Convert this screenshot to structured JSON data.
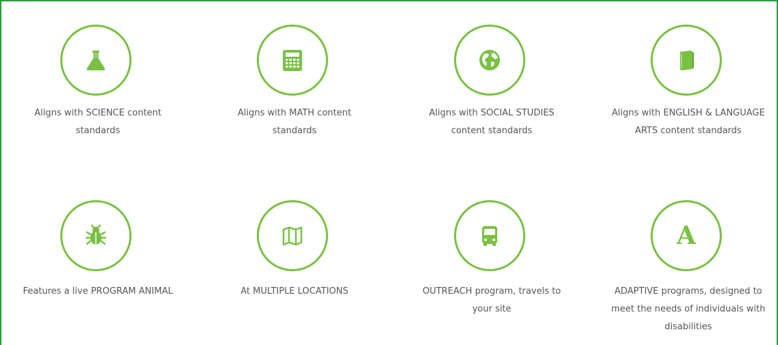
{
  "accent_color": "#78c142",
  "frame_color": "#1fa035",
  "features": [
    {
      "icon": "flask-icon",
      "label": "Aligns with SCIENCE content standards"
    },
    {
      "icon": "calculator-icon",
      "label": "Aligns with MATH content standards"
    },
    {
      "icon": "globe-icon",
      "label": "Aligns with SOCIAL STUDIES content standards"
    },
    {
      "icon": "book-icon",
      "label": "Aligns with ENGLISH & LANGUAGE ARTS content standards"
    },
    {
      "icon": "bug-icon",
      "label": "Features a live PROGRAM ANIMAL"
    },
    {
      "icon": "map-icon",
      "label": "At MULTIPLE LOCATIONS"
    },
    {
      "icon": "bus-icon",
      "label": "OUTREACH program, travels to your site"
    },
    {
      "icon": "letter-a-icon",
      "label": "ADAPTIVE programs, designed to meet the needs of individuals with disabilities",
      "glyph": "A"
    }
  ]
}
